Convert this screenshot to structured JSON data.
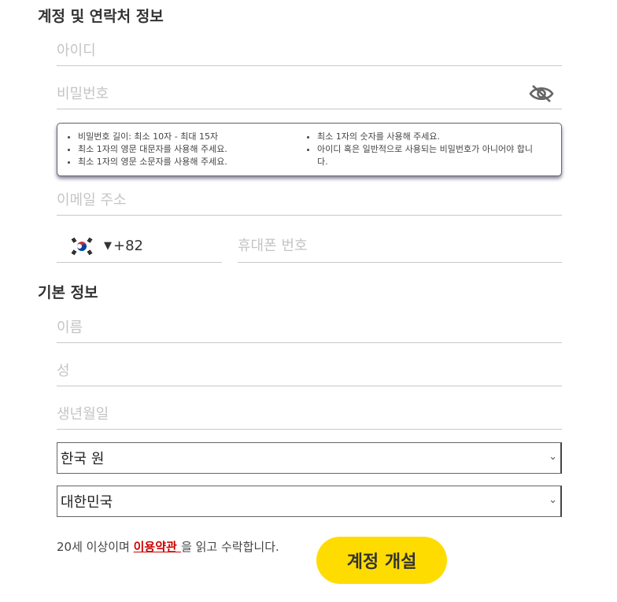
{
  "sections": {
    "account_title": "계정 및 연락처 정보",
    "basic_title": "기본 정보"
  },
  "fields": {
    "id_placeholder": "아이디",
    "password_placeholder": "비밀번호",
    "email_placeholder": "이메일 주소",
    "phone_placeholder": "휴대폰 번호",
    "first_name_placeholder": "이름",
    "last_name_placeholder": "성",
    "birthdate_placeholder": "생년월일"
  },
  "password_rules": {
    "left": [
      "비밀번호 길이: 최소 10자 - 최대 15자",
      "최소 1자의 영문 대문자를 사용해 주세요.",
      "최소 1자의 영문 소문자를 사용해 주세요."
    ],
    "right": [
      "최소 1자의 숫자를 사용해 주세요.",
      "아이디 혹은 일반적으로 사용되는 비밀번호가 아니어야 합니다."
    ]
  },
  "phone": {
    "country_code": "+82",
    "caret": "▼",
    "flag_icon": "south-korea-flag-icon"
  },
  "selects": {
    "currency": "한국 원",
    "country": "대한민국",
    "chevron": "⌄"
  },
  "terms": {
    "prefix": "20세 이상이며 ",
    "link": "이용약관 ",
    "suffix": "을 읽고 수락합니다."
  },
  "submit_label": "계정 개설",
  "colors": {
    "submit_bg": "#ffdc00",
    "terms_link": "#cc0000",
    "placeholder": "#c4c4c4"
  }
}
